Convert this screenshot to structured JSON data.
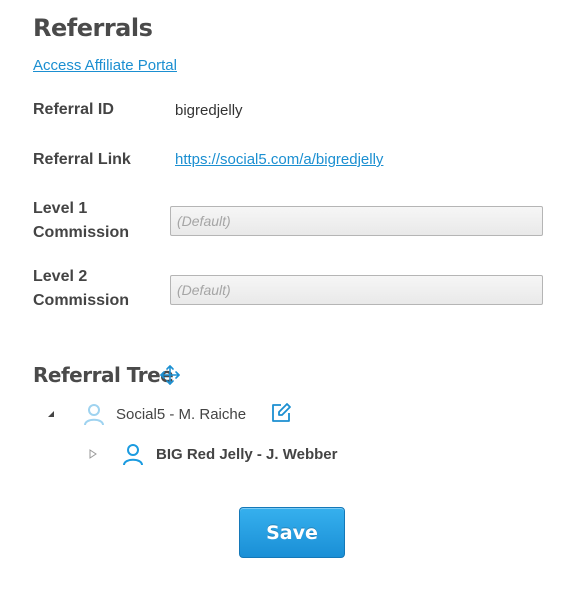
{
  "page": {
    "title": "Referrals",
    "affiliate_link": "Access Affiliate Portal"
  },
  "form": {
    "referral_id_label": "Referral ID",
    "referral_id_value": "bigredjelly",
    "referral_link_label": "Referral Link",
    "referral_link_value": "https://social5.com/a/bigredjelly",
    "level1_label_line1": "Level 1",
    "level1_label_line2": "Commission",
    "level1_placeholder": "(Default)",
    "level1_value": "",
    "level2_label_line1": "Level 2",
    "level2_label_line2": "Commission",
    "level2_placeholder": "(Default)",
    "level2_value": ""
  },
  "tree": {
    "title": "Referral Tree",
    "nodes": [
      {
        "label": "Social5 - M. Raiche",
        "state": "expanded",
        "icon": "user-icon",
        "editable": true
      },
      {
        "label": "BIG Red Jelly - J. Webber",
        "state": "collapsed",
        "icon": "user-icon",
        "bold": true
      }
    ]
  },
  "actions": {
    "save_label": "Save"
  },
  "colors": {
    "accent": "#1b8fd1",
    "heading": "#4a4a4a",
    "user_icon_light": "#9fd3f0",
    "user_icon_active": "#1b9be0"
  }
}
